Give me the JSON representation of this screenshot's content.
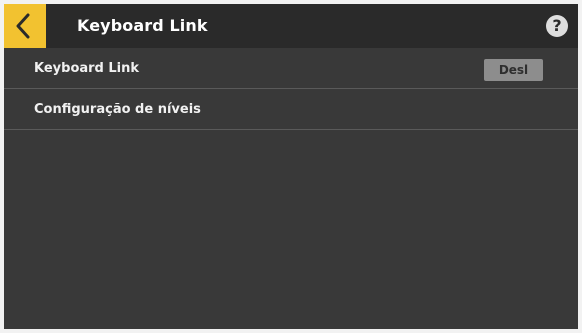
{
  "header": {
    "title": "Keyboard Link",
    "back_icon": "chevron-left-icon",
    "help_icon": "question-circle-icon",
    "help_glyph": "?"
  },
  "settings": {
    "items": [
      {
        "label": "Keyboard Link",
        "value": "Desl"
      },
      {
        "label": "Configuração de níveis"
      }
    ]
  },
  "colors": {
    "accent": "#f2c230",
    "background": "#393939",
    "header": "#2a2a2a",
    "toggle": "#8d8d8d"
  }
}
